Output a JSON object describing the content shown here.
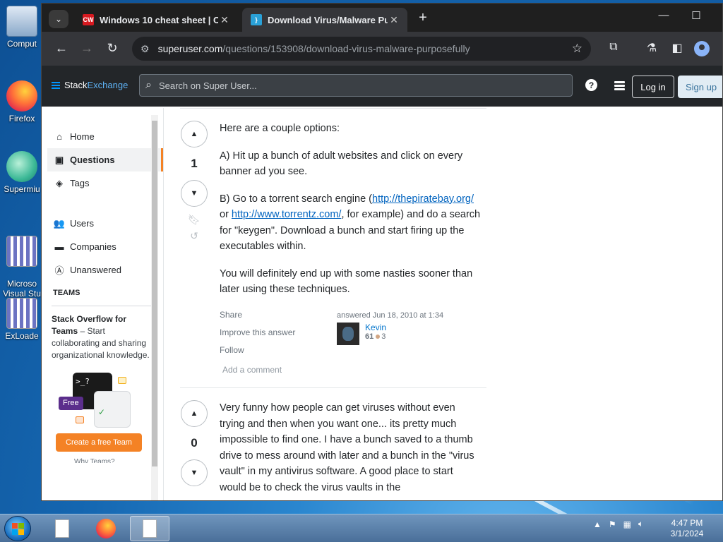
{
  "desktop": {
    "icons": [
      {
        "label": "Comput",
        "icon": "computer-icon"
      },
      {
        "label": "Firefox",
        "icon": "firefox-icon"
      },
      {
        "label": "Supermiu",
        "icon": "app-icon"
      },
      {
        "label": "Microso\nVisual Stu",
        "icon": "visual-studio-icon"
      },
      {
        "label": "ExLoade",
        "icon": "app-icon"
      }
    ]
  },
  "browser": {
    "tabs": [
      {
        "title": "Windows 10 cheat sheet | Com",
        "favicon": "CW",
        "active": false
      },
      {
        "title": "Download Virus/Malware Purp",
        "favicon": "}",
        "active": true
      }
    ],
    "url_domain": "superuser.com",
    "url_path": "/questions/153908/download-virus-malware-purposefully"
  },
  "site": {
    "logo_stack": "Stack",
    "logo_exchange": "Exchange",
    "search_placeholder": "Search on Super User...",
    "login_label": "Log in",
    "signup_label": "Sign up"
  },
  "leftnav": {
    "items": [
      {
        "label": "Home",
        "icon": "home-icon"
      },
      {
        "label": "Questions",
        "icon": "questions-icon",
        "active": true
      },
      {
        "label": "Tags",
        "icon": "tag-icon"
      },
      {
        "label": "Users",
        "icon": "users-icon"
      },
      {
        "label": "Companies",
        "icon": "companies-icon"
      },
      {
        "label": "Unanswered",
        "icon": "unanswered-icon"
      }
    ],
    "teams_heading": "TEAMS",
    "teams_title": "Stack Overflow for Teams",
    "teams_text": " – Start collaborating and sharing organizational knowledge.",
    "free_badge": "Free",
    "create_team_label": "Create a free Team",
    "why_teams": "Why Teams?"
  },
  "answers": [
    {
      "votes": "1",
      "paragraphs": [
        "Here are a couple options:",
        "A) Hit up a bunch of adult websites and click on every banner ad you see."
      ],
      "p3_before": "B) Go to a torrent search engine (",
      "link1": "http://thepiratebay.org/",
      "p3_mid": " or ",
      "link2": "http://www.torrentz.com/",
      "p3_after": ", for example) and do a search for \"keygen\". Download a bunch and start firing up the executables within.",
      "p4": "You will definitely end up with some nasties sooner than later using these techniques.",
      "share": "Share",
      "improve": "Improve this answer",
      "follow": "Follow",
      "add_comment": "Add a comment",
      "answered": "answered Jun 18, 2010 at 1:34",
      "user": "Kevin",
      "reputation": "61",
      "bronze": "3"
    },
    {
      "votes": "0",
      "text": "Very funny how people can get viruses without even trying and then when you want one... its pretty much impossible to find one. I have a bunch saved to a thumb drive to mess around with later and a bunch in the \"virus vault\" in my antivirus software. A good place to start would be to check the virus vaults in the"
    }
  ],
  "taskbar": {
    "time": "4:47 PM",
    "date": "3/1/2024"
  }
}
